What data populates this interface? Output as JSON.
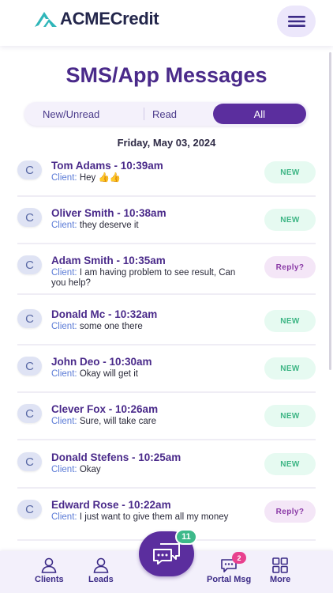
{
  "header": {
    "brand": "ACMECredit",
    "logo_icon": "acme-triangle-logo",
    "menu_icon": "hamburger-menu-icon"
  },
  "page": {
    "title": "SMS/App Messages"
  },
  "filters": {
    "items": [
      "New/Unread",
      "Read",
      "All"
    ],
    "selected": "All"
  },
  "date_header": "Friday, May 03, 2024",
  "messages": [
    {
      "avatar": "C",
      "name": "Tom Adams",
      "time": "10:39am",
      "label": "Client:",
      "text": "Hey 👍👍",
      "status": "NEW"
    },
    {
      "avatar": "C",
      "name": "Oliver Smith",
      "time": "10:38am",
      "label": "Client:",
      "text": "they deserve it",
      "status": "NEW"
    },
    {
      "avatar": "C",
      "name": "Adam Smith",
      "time": "10:35am",
      "label": "Client:",
      "text": "I am having problem to see result, Can you help?",
      "status": "Reply?"
    },
    {
      "avatar": "C",
      "name": "Donald Mc",
      "time": "10:32am",
      "label": "Client:",
      "text": "some one there",
      "status": "NEW"
    },
    {
      "avatar": "C",
      "name": "John Deo",
      "time": "10:30am",
      "label": "Client:",
      "text": "Okay will get it",
      "status": "NEW"
    },
    {
      "avatar": "C",
      "name": "Clever Fox",
      "time": "10:26am",
      "label": "Client:",
      "text": "Sure, will take care",
      "status": "NEW"
    },
    {
      "avatar": "C",
      "name": "Donald Stefens",
      "time": "10:25am",
      "label": "Client:",
      "text": "Okay",
      "status": "NEW"
    },
    {
      "avatar": "C",
      "name": "Edward Rose",
      "time": "10:22am",
      "label": "Client:",
      "text": "I just want to give them all my money",
      "status": "Reply?"
    }
  ],
  "tabbar": {
    "clients": "Clients",
    "leads": "Leads",
    "portal": "Portal Msg",
    "portal_badge": "2",
    "more": "More",
    "fab_badge": "11"
  },
  "colors": {
    "brand_purple": "#5b2e9e",
    "title_purple": "#4a2a8a",
    "new_green": "#3cb584",
    "reply_purple": "#8a3aa6",
    "badge_pink": "#e8408e",
    "logo_teal": "#2fb6b9"
  }
}
